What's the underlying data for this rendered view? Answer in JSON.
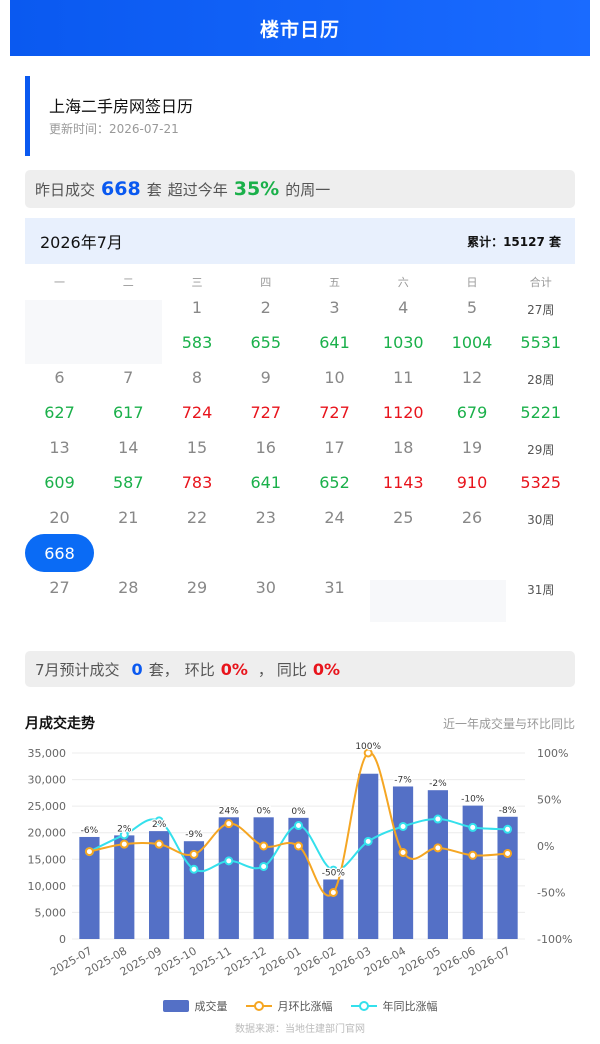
{
  "header": {
    "title": "楼市日历"
  },
  "info": {
    "title": "上海二手房网签日历",
    "updated": "更新时间：2026-07-21"
  },
  "summary": {
    "prefix": "昨日成交",
    "count": "668",
    "unit": "套",
    "mid": "超过今年",
    "percent": "35%",
    "suffix": "的周一"
  },
  "calendar": {
    "month": "2026年7月",
    "total": "累计：15127 套",
    "weekdays": [
      "一",
      "二",
      "三",
      "四",
      "五",
      "六",
      "日",
      "合计"
    ],
    "rows": [
      {
        "days": [
          "",
          "",
          "1",
          "2",
          "3",
          "4",
          "5"
        ],
        "week": "27周",
        "values": [
          "",
          "",
          "583",
          "655",
          "641",
          "1030",
          "1004"
        ],
        "colors": [
          "",
          "",
          "green",
          "green",
          "green",
          "green",
          "green"
        ],
        "sum": "5531",
        "sum_color": "green"
      },
      {
        "days": [
          "6",
          "7",
          "8",
          "9",
          "10",
          "11",
          "12"
        ],
        "week": "28周",
        "values": [
          "627",
          "617",
          "724",
          "727",
          "727",
          "1120",
          "679"
        ],
        "colors": [
          "green",
          "green",
          "red",
          "red",
          "red",
          "red",
          "green"
        ],
        "sum": "5221",
        "sum_color": "green"
      },
      {
        "days": [
          "13",
          "14",
          "15",
          "16",
          "17",
          "18",
          "19"
        ],
        "week": "29周",
        "values": [
          "609",
          "587",
          "783",
          "641",
          "652",
          "1143",
          "910"
        ],
        "colors": [
          "green",
          "green",
          "red",
          "green",
          "green",
          "red",
          "red"
        ],
        "sum": "5325",
        "sum_color": "red"
      },
      {
        "days": [
          "20",
          "21",
          "22",
          "23",
          "24",
          "25",
          "26"
        ],
        "week": "30周",
        "values": [
          "668",
          "",
          "",
          "",
          "",
          "",
          ""
        ],
        "colors": [
          "today",
          "",
          "",
          "",
          "",
          "",
          ""
        ],
        "sum": "",
        "sum_color": ""
      },
      {
        "days": [
          "27",
          "28",
          "29",
          "30",
          "31",
          "",
          ""
        ],
        "week": "31周",
        "values": [],
        "colors": [],
        "sum": "",
        "sum_color": ""
      }
    ]
  },
  "forecast": {
    "prefix": "7月预计成交",
    "count": "0",
    "unit": "套，",
    "mom_label": "环比",
    "mom": "0%",
    "sep": "，",
    "yoy_label": "同比",
    "yoy": "0%"
  },
  "trend": {
    "title": "月成交走势",
    "subtitle": "近一年成交量与环比同比"
  },
  "chart_data": {
    "type": "bar",
    "categories": [
      "2025-07",
      "2025-08",
      "2025-09",
      "2025-10",
      "2025-11",
      "2025-12",
      "2026-01",
      "2026-02",
      "2026-03",
      "2026-04",
      "2026-05",
      "2026-06",
      "2026-07"
    ],
    "series": [
      {
        "name": "成交量",
        "type": "bar",
        "color": "#5470c6",
        "values": [
          19200,
          19500,
          20300,
          18400,
          22900,
          22900,
          22800,
          11200,
          31100,
          28700,
          28000,
          25100,
          23000
        ]
      },
      {
        "name": "月环比涨幅",
        "type": "line",
        "color": "#f5a623",
        "values": [
          -6,
          2,
          2,
          -9,
          24,
          0,
          0,
          -50,
          100,
          -7,
          -2,
          -10,
          -8
        ],
        "labels": [
          "-6%",
          "2%",
          "2%",
          "-9%",
          "24%",
          "0%",
          "0%",
          "-50%",
          "100%",
          "-7%",
          "-2%",
          "-10%",
          "-8%"
        ]
      },
      {
        "name": "年同比涨幅",
        "type": "line",
        "color": "#34e0ec",
        "values": [
          -6,
          12,
          27,
          -25,
          -16,
          -22,
          22,
          -26,
          5,
          21,
          29,
          20,
          18
        ]
      }
    ],
    "y_left": {
      "ticks": [
        "0",
        "5,000",
        "10,000",
        "15,000",
        "20,000",
        "25,000",
        "30,000",
        "35,000"
      ],
      "range": [
        0,
        35000
      ]
    },
    "y_right": {
      "ticks": [
        "-100%",
        "-50%",
        "0%",
        "50%",
        "100%"
      ],
      "range": [
        -100,
        100
      ]
    },
    "legend_position": "bottom",
    "grid": true
  },
  "source": "数据来源：当地住建部门官网"
}
